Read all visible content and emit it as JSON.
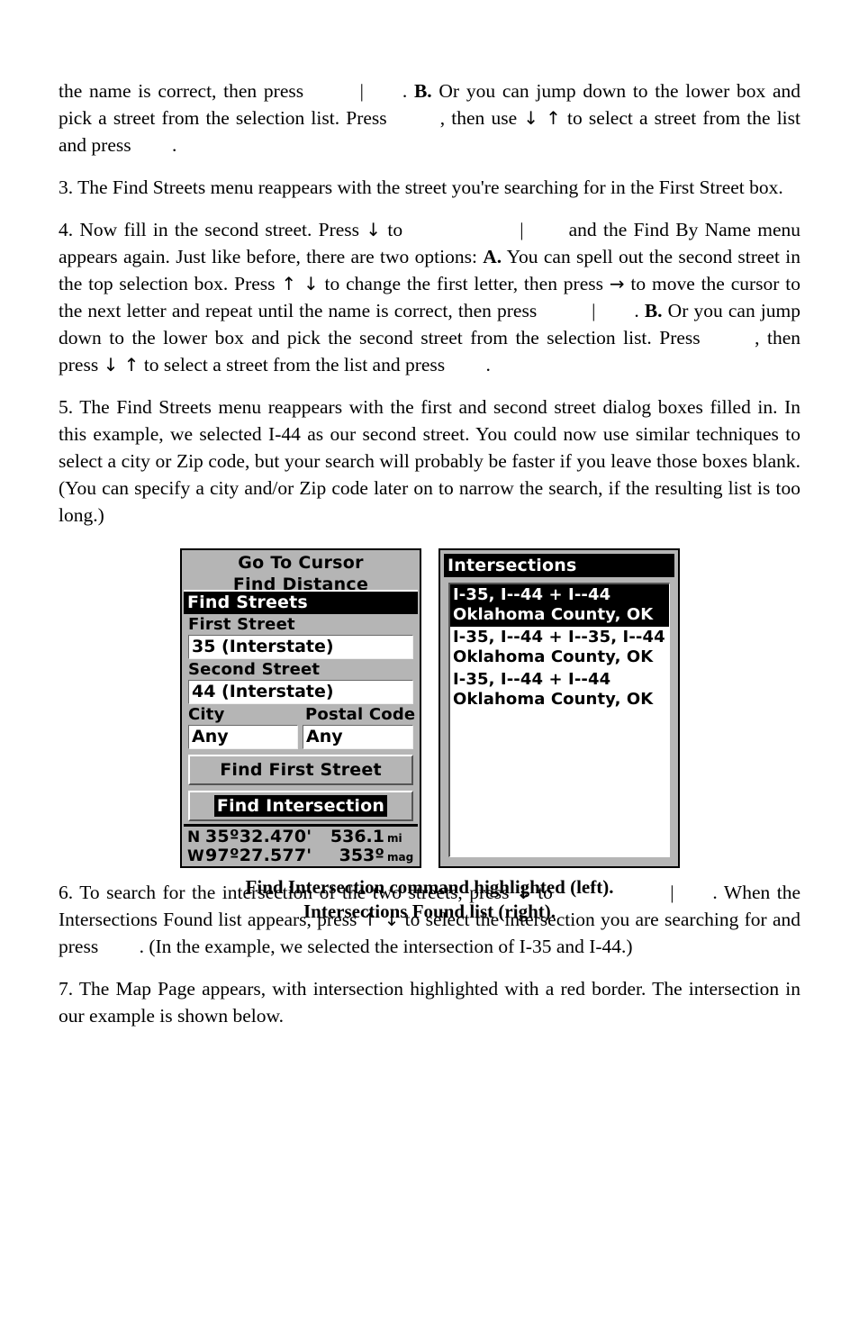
{
  "document": {
    "paragraphs": [
      {
        "id": "p-continued",
        "segments": [
          {
            "type": "text",
            "text": "the name is correct, then press "
          },
          {
            "type": "keygap"
          },
          {
            "type": "bar",
            "text": "|"
          },
          {
            "type": "keygap-sm"
          },
          {
            "type": "text",
            "text": ". "
          },
          {
            "type": "bold",
            "text": "B."
          },
          {
            "type": "text",
            "text": " Or you can jump down to the lower box and pick a street from the selection list. Press "
          },
          {
            "type": "keygap"
          },
          {
            "type": "text",
            "text": ", then use "
          },
          {
            "type": "arrow",
            "text": "↓ ↑"
          },
          {
            "type": "text",
            "text": " to select a street from the list and press "
          },
          {
            "type": "keygap-sm"
          },
          {
            "type": "text",
            "text": "."
          }
        ]
      },
      {
        "id": "p-3",
        "segments": [
          {
            "type": "text",
            "text": "3. The Find Streets menu reappears with the street you're searching for in the First Street box."
          }
        ]
      },
      {
        "id": "p-4",
        "segments": [
          {
            "type": "text",
            "text": "4. Now fill in the second street. Press "
          },
          {
            "type": "arrow",
            "text": "↓"
          },
          {
            "type": "text",
            "text": " to "
          },
          {
            "type": "keygap-lg"
          },
          {
            "type": "bar",
            "text": "|"
          },
          {
            "type": "keygap-sm"
          },
          {
            "type": "text",
            "text": " and the Find By Name menu appears again. Just like before, there are two options: "
          },
          {
            "type": "bold",
            "text": "A."
          },
          {
            "type": "text",
            "text": " You can spell out the second street in the top selection box. Press "
          },
          {
            "type": "arrow",
            "text": "↑ ↓"
          },
          {
            "type": "text",
            "text": " to change the first letter, then press "
          },
          {
            "type": "arrow",
            "text": "→"
          },
          {
            "type": "text",
            "text": " to move the cursor to the next letter and repeat until the name is correct, then press "
          },
          {
            "type": "keygap"
          },
          {
            "type": "bar",
            "text": "|"
          },
          {
            "type": "keygap-sm"
          },
          {
            "type": "text",
            "text": ". "
          },
          {
            "type": "bold",
            "text": "B."
          },
          {
            "type": "text",
            "text": " Or you can jump down to the lower box and pick the second street from the selection list. Press "
          },
          {
            "type": "keygap"
          },
          {
            "type": "text",
            "text": ", then press "
          },
          {
            "type": "arrow",
            "text": "↓ ↑"
          },
          {
            "type": "text",
            "text": " to select a street from the list and press "
          },
          {
            "type": "keygap-sm"
          },
          {
            "type": "text",
            "text": "."
          }
        ]
      },
      {
        "id": "p-5",
        "segments": [
          {
            "type": "text",
            "text": "5. The Find Streets menu reappears with the first and second street dialog boxes filled in. In this example, we selected I-44 as our second street. You could now use similar techniques to select a city or Zip code, but your search will probably be faster if you leave those boxes blank. (You can specify a city and/or Zip code later on to narrow the search, if the resulting list is too long.)"
          }
        ]
      },
      {
        "id": "p-6",
        "segments": [
          {
            "type": "text",
            "text": "6. To search for the intersection of the two streets, press "
          },
          {
            "type": "arrow",
            "text": "↓"
          },
          {
            "type": "text",
            "text": " to "
          },
          {
            "type": "keygap-lg"
          },
          {
            "type": "bar",
            "text": "|"
          },
          {
            "type": "keygap-sm"
          },
          {
            "type": "text",
            "text": ". When the Intersections Found list appears, press "
          },
          {
            "type": "arrow",
            "text": "↑ ↓"
          },
          {
            "type": "text",
            "text": " to select the intersection you are searching for and press "
          },
          {
            "type": "keygap-sm"
          },
          {
            "type": "text",
            "text": ". (In the example, we selected the intersection of I-35 and I-44.)"
          }
        ]
      },
      {
        "id": "p-7",
        "segments": [
          {
            "type": "text",
            "text": "7. The Map Page appears, with intersection highlighted with a red border. The intersection in our example is shown below."
          }
        ]
      }
    ]
  },
  "figure": {
    "caption_line1": "Find Intersection command highlighted (left).",
    "caption_line2": "Intersections Found list (right).",
    "left_screen": {
      "background_menu_items": [
        "Go To Cursor",
        "Find Distance"
      ],
      "dialog_title": "Find Streets",
      "fields": [
        {
          "label": "First Street",
          "value": "35 (Interstate)"
        },
        {
          "label": "Second Street",
          "value": "44 (Interstate)"
        }
      ],
      "paired_fields": [
        {
          "label": "City",
          "value": "Any"
        },
        {
          "label": "Postal Code",
          "value": "Any"
        }
      ],
      "buttons": [
        {
          "label": "Find First Street",
          "selected": false
        },
        {
          "label": "Find Intersection",
          "selected": true
        }
      ],
      "status": {
        "lat_hemi": "N",
        "lat": "35º32.470'",
        "lon_hemi": "W",
        "lon": "97º27.577'",
        "distance": "536.1",
        "distance_unit": "mi",
        "bearing": "353º",
        "bearing_unit": "mag"
      }
    },
    "right_screen": {
      "title": "Intersections",
      "items": [
        {
          "line1": "I-35, I--44 + I--44",
          "line2": "Oklahoma County, OK",
          "selected": true
        },
        {
          "line1": "I-35, I--44 + I--35, I--44",
          "line2": "Oklahoma County, OK",
          "selected": false
        },
        {
          "line1": "I-35, I--44 + I--44",
          "line2": "Oklahoma County, OK",
          "selected": false
        }
      ]
    }
  },
  "colors": {
    "page_background": "#ffffff",
    "text": "#000000",
    "lcd_gray": "#b5b5b5",
    "lcd_white": "#ffffff",
    "lcd_black": "#000000"
  }
}
